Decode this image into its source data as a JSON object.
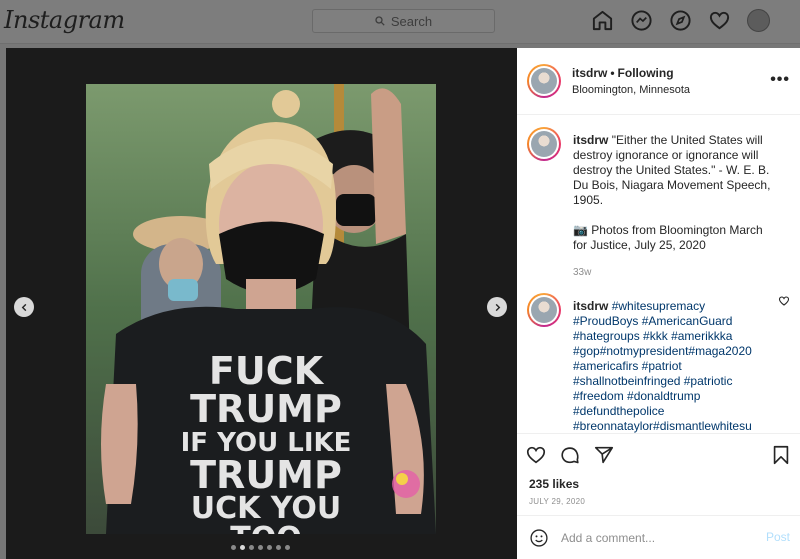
{
  "topbar": {
    "logo": "Instagram",
    "search_placeholder": "Search"
  },
  "post": {
    "username": "itsdrw",
    "follow_status": "Following",
    "location": "Bloomington, Minnesota",
    "more_label": "•••",
    "photo_shirt_text": [
      "FUCK",
      "TRUMP",
      "IF YOU LIKE",
      "TRUMP",
      "UCK YOU",
      "TOO"
    ],
    "carousel_count": 7,
    "carousel_active_index": 1
  },
  "caption": {
    "username": "itsdrw",
    "text": "\"Either the United States will destroy ignorance or ignorance will destroy the United States.\" - W. E. B. Du Bois, Niagara Movement Speech, 1905.",
    "text2": "📷 Photos from Bloomington March for Justice, July 25, 2020",
    "age": "33w"
  },
  "comment": {
    "username": "itsdrw",
    "tags": "#whitesupremacy #ProudBoys #AmericanGuard #hategroups #kkk #amerikkka #gop#notmypresident#maga2020 #americafirs #patriot #shallnotbeinfringed #patriotic #freedom #donaldtrump #defundthepolice #breonnataylor#dismantlewhitesu"
  },
  "actions": {
    "likes": "235 likes",
    "date": "JULY 29, 2020"
  },
  "add_comment": {
    "placeholder": "Add a comment...",
    "post_label": "Post"
  },
  "colors": {
    "link": "#00376b",
    "post_button": "#b2dffc",
    "meta_gray": "#8e8e8e"
  }
}
